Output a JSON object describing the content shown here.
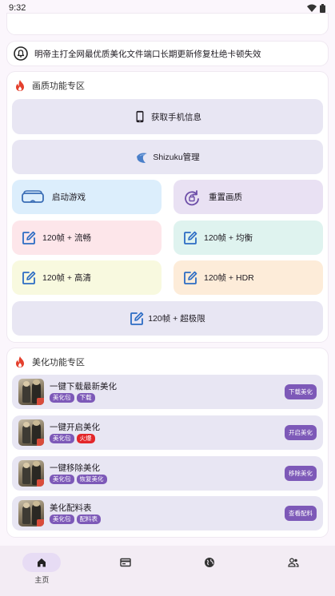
{
  "status_bar": {
    "time": "9:32",
    "icons": [
      "wifi-icon",
      "battery-icon"
    ]
  },
  "notice": {
    "icon": "notice-bell-icon",
    "text": "明帝主打全网最优质美化文件端口长期更新修复杜绝卡顿失效"
  },
  "quality_section": {
    "title": "画质功能专区",
    "icon": "flame-icon",
    "buttons": {
      "phone_info": "获取手机信息",
      "shizuku": "Shizuku管理",
      "launch_game": "启动游戏",
      "reset_quality": "重置画质",
      "fps_smooth": "120帧 + 流畅",
      "fps_balanced": "120帧 + 均衡",
      "fps_hd": "120帧 + 高清",
      "fps_hdr": "120帧 + HDR",
      "fps_extreme": "120帧 + 超极限"
    },
    "colors": {
      "gray": "#e8e6f3",
      "blue": "#dceefc",
      "lavender": "#e9e1f3",
      "pink": "#fde6ea",
      "mint": "#dff3ef",
      "cream": "#f8f9df",
      "peach": "#fdecd9"
    }
  },
  "beauty_section": {
    "title": "美化功能专区",
    "icon": "flame-icon",
    "items": [
      {
        "title": "一键下载最新美化",
        "tags": [
          "美化包",
          "下载"
        ],
        "action": "下载美化"
      },
      {
        "title": "一键开启美化",
        "tags": [
          "美化包",
          "火爆"
        ],
        "action": "开启美化"
      },
      {
        "title": "一键移除美化",
        "tags": [
          "美化包",
          "恢复美化"
        ],
        "action": "移除美化"
      },
      {
        "title": "美化配料表",
        "tags": [
          "美化包",
          "配料表"
        ],
        "action": "查看配料"
      }
    ],
    "accent": "#7d59b8",
    "hot_color": "#e3262a"
  },
  "bottom_nav": {
    "items": [
      {
        "label": "主页",
        "icon": "home-icon",
        "active": true
      },
      {
        "label": "",
        "icon": "card-icon",
        "active": false
      },
      {
        "label": "",
        "icon": "globe-icon",
        "active": false
      },
      {
        "label": "",
        "icon": "users-icon",
        "active": false
      }
    ]
  }
}
